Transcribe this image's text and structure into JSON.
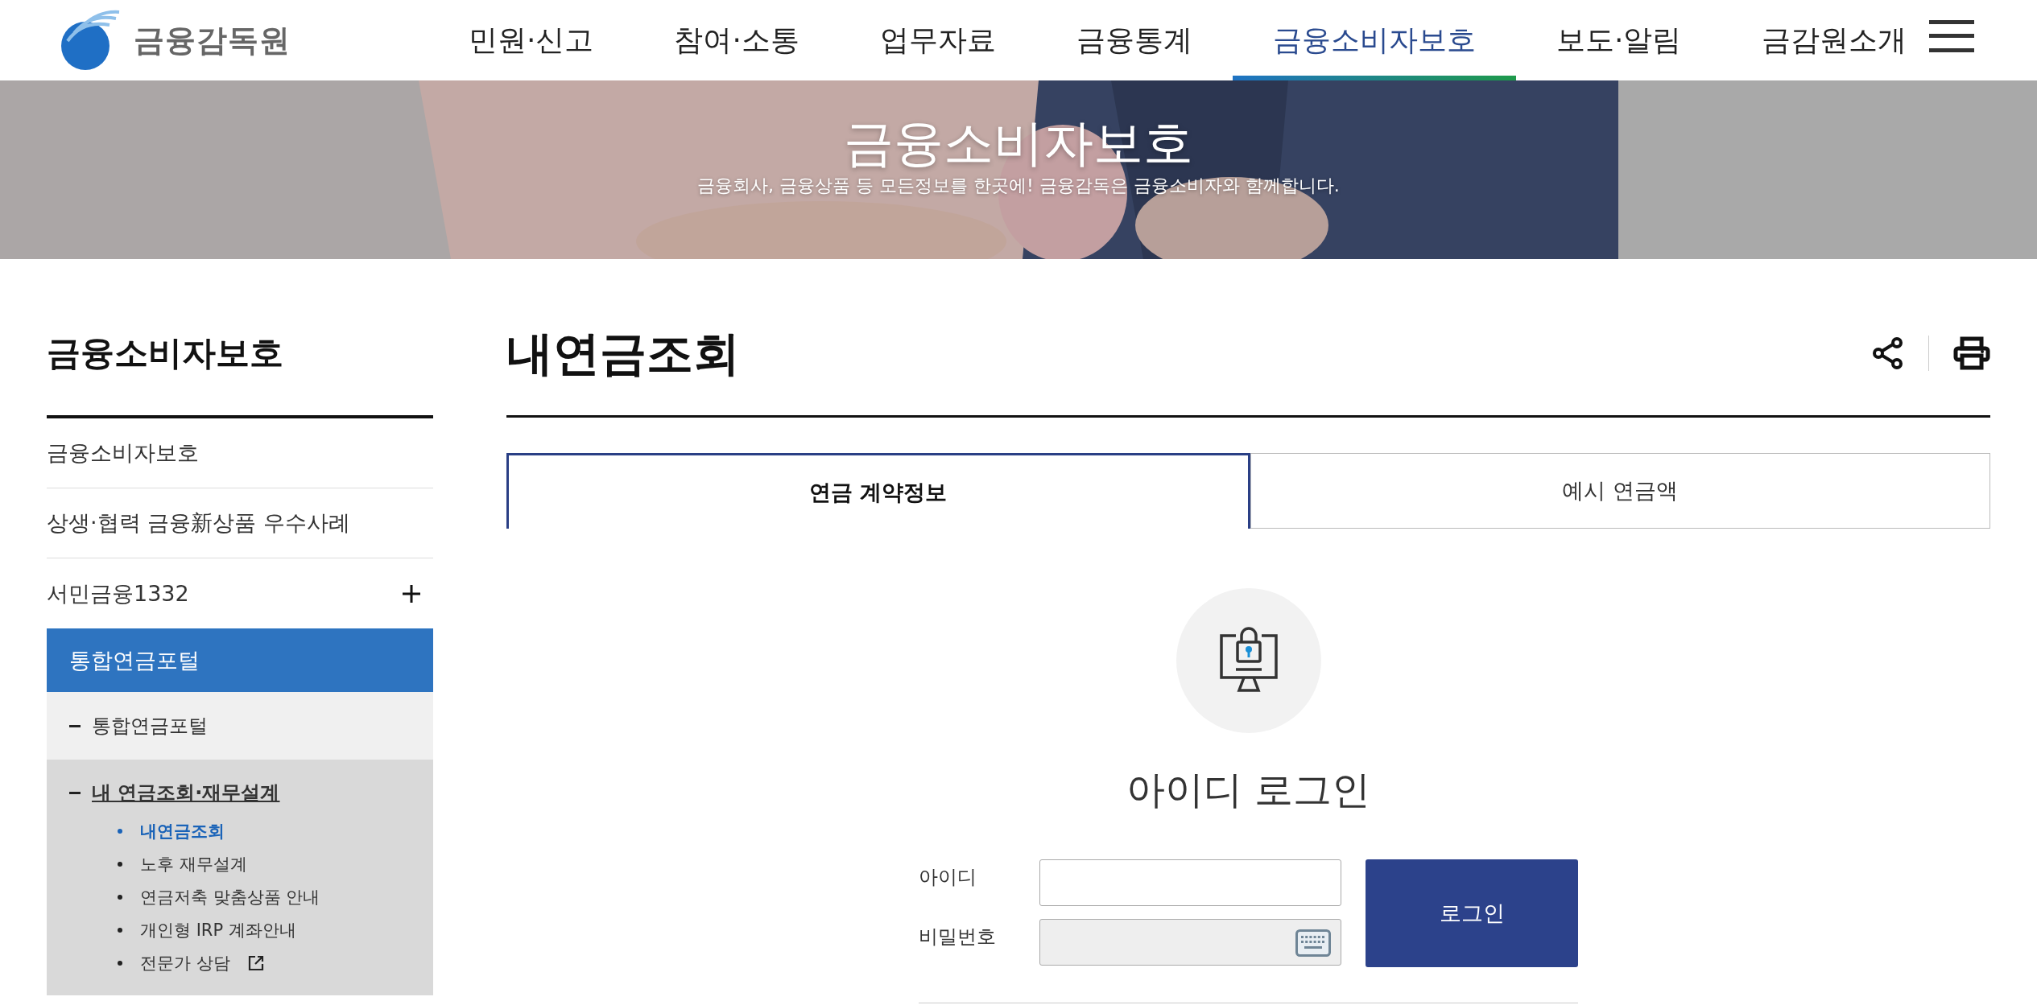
{
  "header": {
    "logo_text": "금융감독원",
    "nav": [
      {
        "label": "민원·신고",
        "selected": false
      },
      {
        "label": "참여·소통",
        "selected": false
      },
      {
        "label": "업무자료",
        "selected": false
      },
      {
        "label": "금융통계",
        "selected": false
      },
      {
        "label": "금융소비자보호",
        "selected": true
      },
      {
        "label": "보도·알림",
        "selected": false
      },
      {
        "label": "금감원소개",
        "selected": false
      }
    ]
  },
  "banner": {
    "title": "금융소비자보호",
    "subtitle": "금융회사, 금융상품 등 모든정보를 한곳에! 금융감독은 금융소비자와 함께합니다."
  },
  "sidebar": {
    "title": "금융소비자보호",
    "items": [
      {
        "label": "금융소비자보호",
        "kind": "link"
      },
      {
        "label": "상생·협력 금융新상품 우수사례",
        "kind": "link"
      },
      {
        "label": "서민금융1332",
        "kind": "expandable",
        "expanded": false
      },
      {
        "label": "통합연금포털",
        "kind": "section",
        "expanded": true,
        "children": [
          {
            "label": "통합연금포털",
            "selected": false
          },
          {
            "label": "내 연금조회·재무설계",
            "selected": true,
            "children": [
              {
                "label": "내연금조회",
                "selected": true,
                "external": false
              },
              {
                "label": "노후 재무설계",
                "selected": false,
                "external": false
              },
              {
                "label": "연금저축 맞춤상품 안내",
                "selected": false,
                "external": false
              },
              {
                "label": "개인형 IRP 계좌안내",
                "selected": false,
                "external": false
              },
              {
                "label": "전문가 상담",
                "selected": false,
                "external": true
              }
            ]
          }
        ]
      }
    ]
  },
  "main": {
    "title": "내연금조회",
    "tabs": [
      {
        "label": "연금 계약정보",
        "selected": true
      },
      {
        "label": "예시 연금액",
        "selected": false
      }
    ],
    "login": {
      "title": "아이디 로그인",
      "fields": [
        {
          "label": "아이디",
          "kind": "text",
          "disabled": false
        },
        {
          "label": "비밀번호",
          "kind": "password",
          "disabled": true
        }
      ],
      "button": "로그인"
    }
  }
}
